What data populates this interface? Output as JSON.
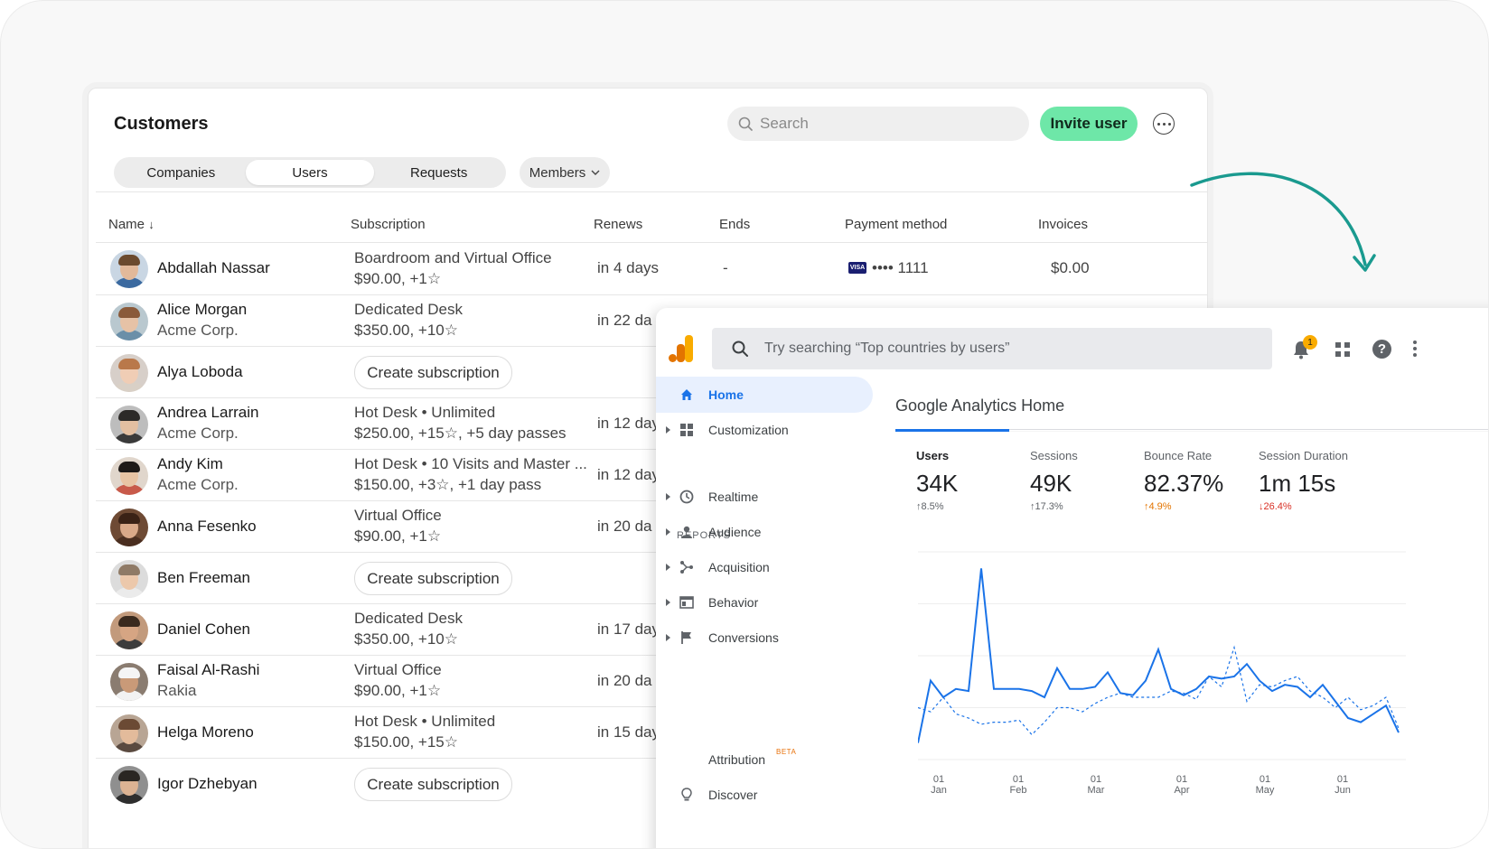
{
  "customers": {
    "title": "Customers",
    "search_placeholder": "Search",
    "invite_label": "Invite user",
    "tabs": [
      {
        "label": "Companies",
        "active": false
      },
      {
        "label": "Users",
        "active": true
      },
      {
        "label": "Requests",
        "active": false
      }
    ],
    "members_label": "Members",
    "columns": [
      "Name",
      "Subscription",
      "Renews",
      "Ends",
      "Payment method",
      "Invoices"
    ],
    "sort_indicator": "↓",
    "create_subscription_label": "Create subscription",
    "rows": [
      {
        "name": "Abdallah Nassar",
        "company": "",
        "plan": "Boardroom and Virtual Office",
        "price": "$90.00, +1☆",
        "renews": "in 4 days",
        "ends": "-",
        "payment": "•••• 1111",
        "card_brand": "VISA",
        "invoices": "$0.00"
      },
      {
        "name": "Alice Morgan",
        "company": "Acme Corp.",
        "plan": "Dedicated Desk",
        "price": "$350.00, +10☆",
        "renews": "in 22 da"
      },
      {
        "name": "Alya Loboda",
        "company": "",
        "create": true
      },
      {
        "name": "Andrea Larrain",
        "company": "Acme Corp.",
        "plan": "Hot Desk • Unlimited",
        "price": "$250.00, +15☆, +5 day passes",
        "renews": "in 12 day"
      },
      {
        "name": "Andy Kim",
        "company": "Acme Corp.",
        "plan": "Hot Desk • 10 Visits and Master ...",
        "price": "$150.00, +3☆, +1 day pass",
        "renews": "in 12 day"
      },
      {
        "name": "Anna Fesenko",
        "company": "",
        "plan": "Virtual Office",
        "price": "$90.00, +1☆",
        "renews": "in 20 da"
      },
      {
        "name": "Ben Freeman",
        "company": "",
        "create": true
      },
      {
        "name": "Daniel Cohen",
        "company": "",
        "plan": "Dedicated Desk",
        "price": "$350.00, +10☆",
        "renews": "in 17 day"
      },
      {
        "name": "Faisal Al-Rashi",
        "company": "Rakia",
        "plan": "Virtual Office",
        "price": "$90.00, +1☆",
        "renews": "in 20 da"
      },
      {
        "name": "Helga Moreno",
        "company": "",
        "plan": "Hot Desk • Unlimited",
        "price": "$150.00, +15☆",
        "renews": "in 15 day"
      },
      {
        "name": "Igor Dzhebyan",
        "company": "",
        "create": true
      }
    ]
  },
  "analytics": {
    "search_placeholder": "Try searching “Top countries by users”",
    "notification_count": "1",
    "help_label": "?",
    "nav": {
      "home": "Home",
      "customization": "Customization",
      "reports_label": "REPORTS",
      "realtime": "Realtime",
      "audience": "Audience",
      "acquisition": "Acquisition",
      "behavior": "Behavior",
      "conversions": "Conversions",
      "attribution": "Attribution",
      "beta": "BETA",
      "discover": "Discover"
    },
    "title": "Google Analytics Home",
    "metrics": [
      {
        "label": "Users",
        "value": "34K",
        "delta": "↑8.5%",
        "trend": "up"
      },
      {
        "label": "Sessions",
        "value": "49K",
        "delta": "↑17.3%",
        "trend": "up"
      },
      {
        "label": "Bounce Rate",
        "value": "82.37%",
        "delta": "↑4.9%",
        "trend": "warn"
      },
      {
        "label": "Session Duration",
        "value": "1m 15s",
        "delta": "↓26.4%",
        "trend": "down"
      }
    ],
    "colors": {
      "accent": "#1a73e8",
      "invite_green": "#6ee7a8",
      "arrow_teal": "#1a9a8f"
    }
  },
  "chart_data": {
    "type": "line",
    "x_labels": [
      {
        "day": "01",
        "month": "Jan"
      },
      {
        "day": "01",
        "month": "Feb"
      },
      {
        "day": "01",
        "month": "Mar"
      },
      {
        "day": "01",
        "month": "Apr"
      },
      {
        "day": "01",
        "month": "May"
      },
      {
        "day": "01",
        "month": "Jun"
      }
    ],
    "ylim": [
      0,
      100
    ],
    "grid": true,
    "series": [
      {
        "style": "solid",
        "values": [
          8,
          38,
          30,
          34,
          33,
          92,
          34,
          34,
          34,
          33,
          30,
          44,
          34,
          34,
          35,
          42,
          32,
          31,
          38,
          53,
          34,
          31,
          34,
          40,
          39,
          40,
          46,
          38,
          33,
          36,
          35,
          30,
          36,
          28,
          20,
          18,
          22,
          26,
          13
        ]
      },
      {
        "style": "dashed",
        "values": [
          25,
          23,
          30,
          22,
          20,
          17,
          18,
          18,
          19,
          12,
          18,
          25,
          25,
          23,
          27,
          30,
          32,
          30,
          30,
          30,
          33,
          32,
          29,
          40,
          35,
          54,
          28,
          36,
          35,
          38,
          40,
          33,
          30,
          25,
          30,
          24,
          26,
          30,
          15
        ]
      }
    ]
  }
}
